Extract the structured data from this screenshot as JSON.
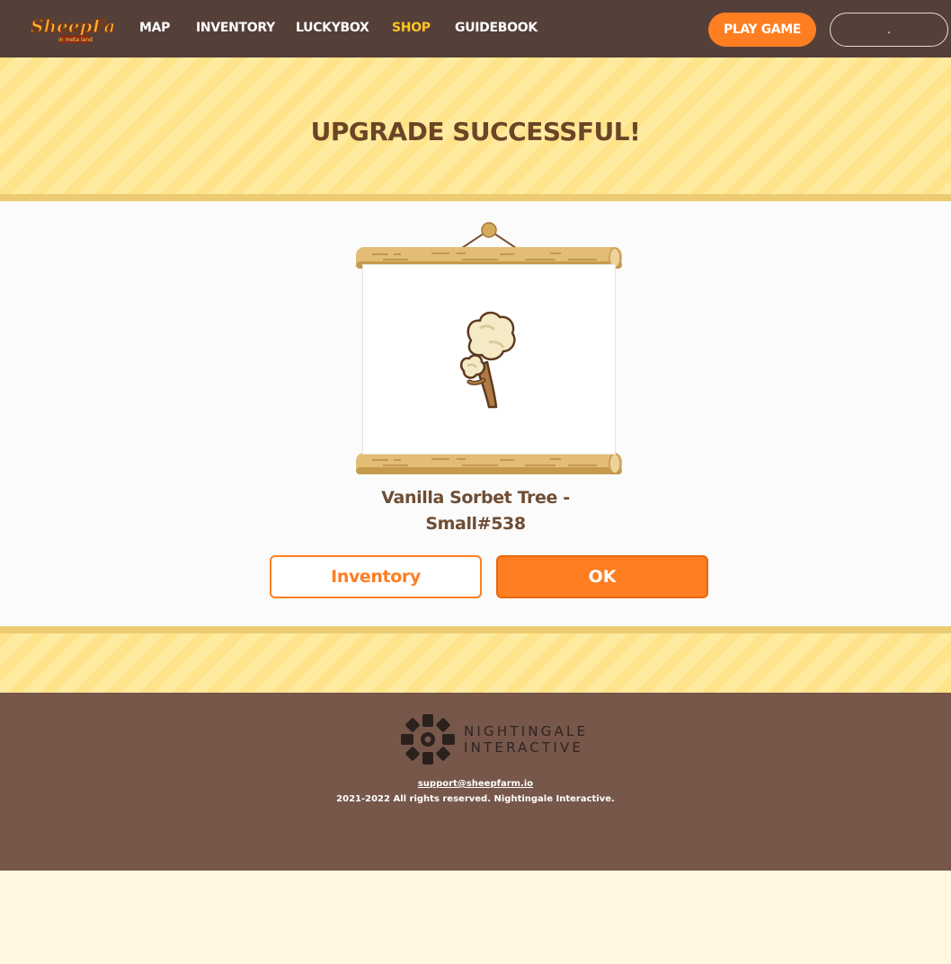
{
  "nav": {
    "logo_text": "SheepFarm",
    "logo_subtext": "in meta land",
    "links": [
      {
        "label": "MAP",
        "active": false
      },
      {
        "label": "INVENTORY",
        "active": false
      },
      {
        "label": "LUCKYBOX",
        "active": false
      },
      {
        "label": "SHOP",
        "active": true
      },
      {
        "label": "GUIDEBOOK",
        "active": false
      }
    ],
    "play_label": "PLAY GAME",
    "wallet_label": "."
  },
  "banner": {
    "title": "UPGRADE SUCCESSFUL!"
  },
  "item": {
    "name_line1": "Vanilla Sorbet Tree -",
    "name_line2": "Small#538",
    "icon": "vanilla-sorbet-tree-icon"
  },
  "actions": {
    "inventory_label": "Inventory",
    "ok_label": "OK"
  },
  "footer": {
    "brand_line1": "NIGHTINGALE",
    "brand_line2": "INTERACTIVE",
    "support_email": "support@sheepfarm.io",
    "copyright": "2021-2022 All rights reserved. Nightingale Interactive."
  },
  "colors": {
    "nav_bg": "#553f39",
    "accent": "#ff7e22",
    "active_link": "#ffc41f",
    "banner_bg": "#ffeba0",
    "title": "#6b4526",
    "footer_bg": "#76574a"
  }
}
